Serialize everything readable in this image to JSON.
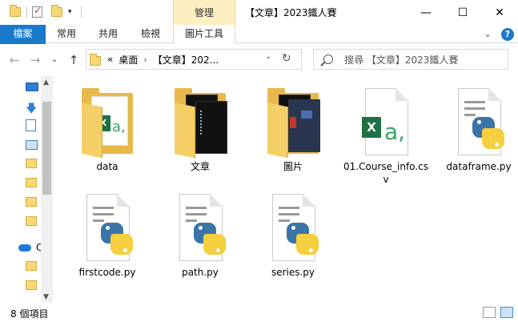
{
  "window": {
    "title": "【文章】2023鐵人賽",
    "manage_tab": "管理",
    "min_glyph": "—",
    "max_glyph": "☐",
    "close_glyph": "✕"
  },
  "ribbon": {
    "tabs": [
      "檔案",
      "常用",
      "共用",
      "檢視",
      "圖片工具"
    ],
    "chevron": "⌄",
    "help": "?"
  },
  "nav": {
    "back": "←",
    "forward": "→",
    "recent": "⌄",
    "up": "↑",
    "overflow": "«",
    "breadcrumb": [
      "桌面",
      "【文章】202..."
    ],
    "crumb_sep": "›",
    "dropdown": "⌄",
    "refresh": "↻",
    "search_placeholder": "搜尋 【文章】2023鐵人賽"
  },
  "sidebar": {
    "cloud_label": "C",
    "scroll_up": "▲",
    "scroll_down": "▼"
  },
  "files": [
    {
      "name": "data",
      "type": "folder"
    },
    {
      "name": "文章",
      "type": "folder"
    },
    {
      "name": "圖片",
      "type": "folder"
    },
    {
      "name": "01.Course_info.csv",
      "type": "csv"
    },
    {
      "name": "dataframe.py",
      "type": "python"
    },
    {
      "name": "firstcode.py",
      "type": "python"
    },
    {
      "name": "path.py",
      "type": "python"
    },
    {
      "name": "series.py",
      "type": "python"
    }
  ],
  "excel": {
    "badge": "X",
    "glyph": "a,"
  },
  "status": {
    "item_count": "8 個項目"
  },
  "colors": {
    "accent": "#1979ca",
    "manage_tab_bg": "#fcf0c3",
    "folder": "#f8d775",
    "excel": "#1e7145",
    "python_blue": "#3b75a8",
    "python_yellow": "#f5cf3d"
  }
}
